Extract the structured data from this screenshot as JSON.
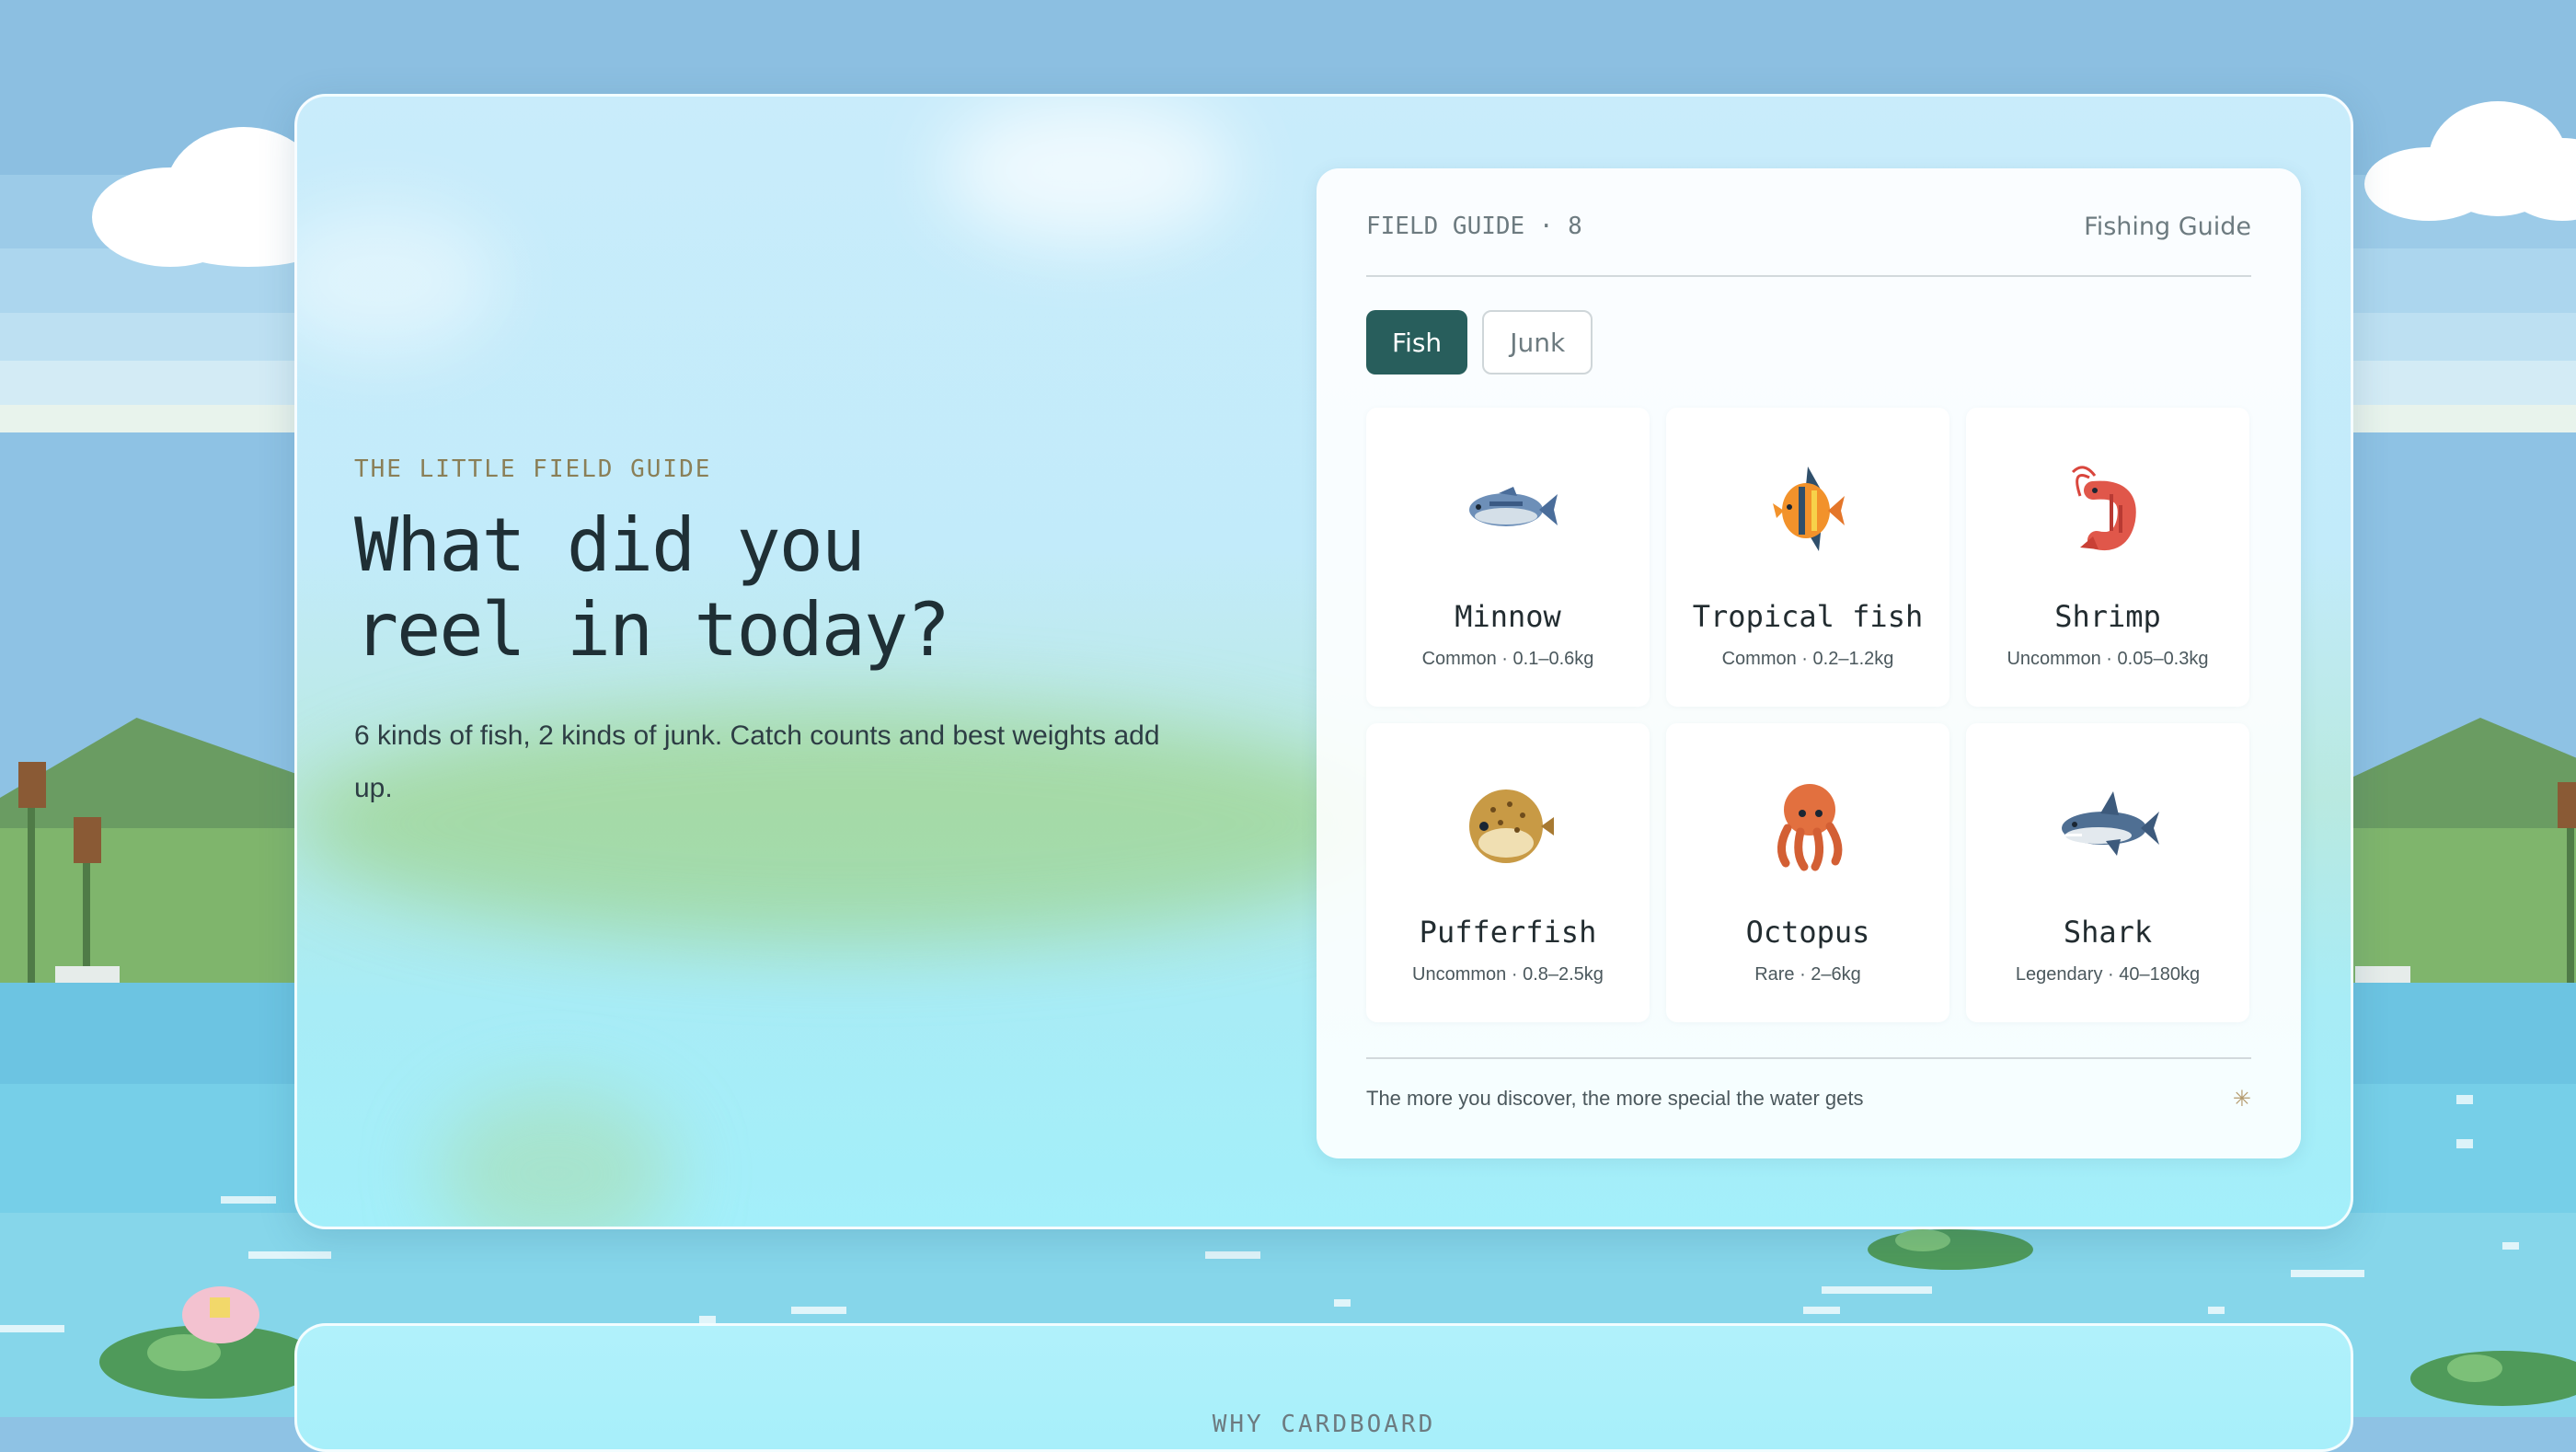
{
  "hero": {
    "eyebrow": "THE LITTLE FIELD GUIDE",
    "headline_line1": "What did you",
    "headline_line2": "reel in today?",
    "subtext": "6 kinds of fish, 2 kinds of junk. Catch counts and best weights add up."
  },
  "guide": {
    "count_label": "FIELD GUIDE · 8",
    "title": "Fishing Guide",
    "tabs": [
      {
        "label": "Fish",
        "active": true
      },
      {
        "label": "Junk",
        "active": false
      }
    ],
    "entries": [
      {
        "name": "Minnow",
        "meta": "Common · 0.1–0.6kg",
        "icon": "minnow-icon"
      },
      {
        "name": "Tropical fish",
        "meta": "Common · 0.2–1.2kg",
        "icon": "tropical-fish-icon"
      },
      {
        "name": "Shrimp",
        "meta": "Uncommon · 0.05–0.3kg",
        "icon": "shrimp-icon"
      },
      {
        "name": "Pufferfish",
        "meta": "Uncommon · 0.8–2.5kg",
        "icon": "pufferfish-icon"
      },
      {
        "name": "Octopus",
        "meta": "Rare · 2–6kg",
        "icon": "octopus-icon"
      },
      {
        "name": "Shark",
        "meta": "Legendary · 40–180kg",
        "icon": "shark-icon"
      }
    ],
    "footer_text": "The more you discover, the more special the water gets",
    "footer_star": "✳"
  },
  "second_card": {
    "label": "WHY CARDBOARD"
  },
  "colors": {
    "accent": "#285e5c",
    "eyebrow": "#8a7f57",
    "sky": "#8ec2e4",
    "water": "#76cfe8"
  }
}
